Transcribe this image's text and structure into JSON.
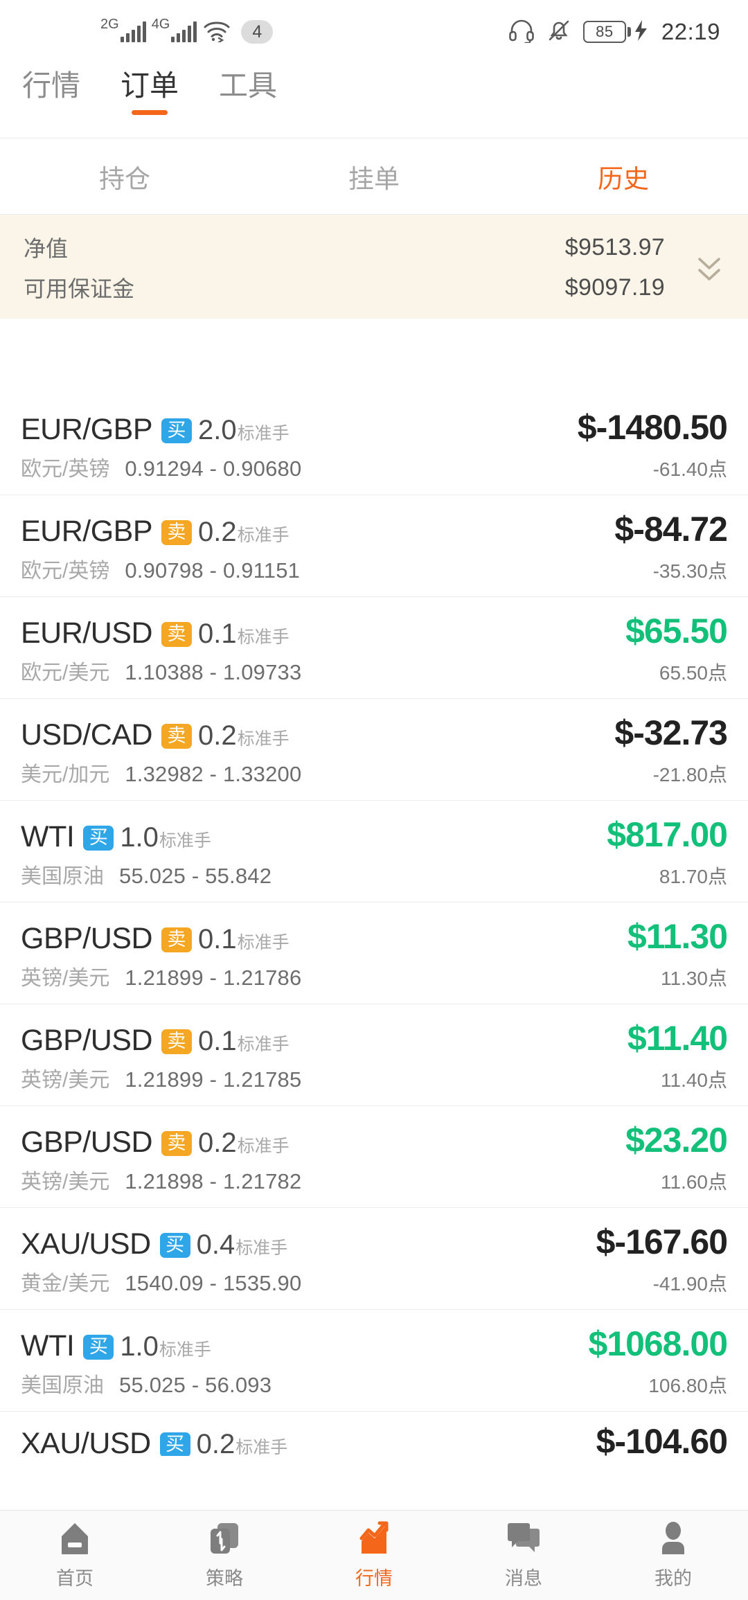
{
  "status_bar": {
    "net1_label": "2G",
    "net2_label": "4G",
    "sim_badge": "4",
    "battery_level": "85",
    "time": "22:19",
    "icons": [
      "headphone-icon",
      "bell-muted-icon",
      "battery-icon",
      "charging-bolt-icon",
      "wifi-icon",
      "signal-bars-icon"
    ]
  },
  "top_tabs": [
    {
      "label": "行情",
      "active": false
    },
    {
      "label": "订单",
      "active": true
    },
    {
      "label": "工具",
      "active": false
    }
  ],
  "sub_tabs": [
    {
      "label": "持仓",
      "active": false
    },
    {
      "label": "挂单",
      "active": false
    },
    {
      "label": "历史",
      "active": true
    }
  ],
  "account_summary": {
    "equity_label": "净值",
    "equity_value": "$9513.97",
    "free_margin_label": "可用保证金",
    "free_margin_value": "$9097.19",
    "expand_icon": "double-chevron-down-icon"
  },
  "lot_unit": "标准手",
  "point_unit": "点",
  "orders": [
    {
      "symbol": "EUR/GBP",
      "side": "买",
      "side_type": "buy",
      "lots": "2.0",
      "cn_name": "欧元/英镑",
      "open_price": "0.91294",
      "close_price": "0.90680",
      "price_range": "0.91294 - 0.90680",
      "profit": "$-1480.50",
      "profit_sign": "neg",
      "points": "-61.40点"
    },
    {
      "symbol": "EUR/GBP",
      "side": "卖",
      "side_type": "sell",
      "lots": "0.2",
      "cn_name": "欧元/英镑",
      "open_price": "0.90798",
      "close_price": "0.91151",
      "price_range": "0.90798 - 0.91151",
      "profit": "$-84.72",
      "profit_sign": "neg",
      "points": "-35.30点"
    },
    {
      "symbol": "EUR/USD",
      "side": "卖",
      "side_type": "sell",
      "lots": "0.1",
      "cn_name": "欧元/美元",
      "open_price": "1.10388",
      "close_price": "1.09733",
      "price_range": "1.10388 - 1.09733",
      "profit": "$65.50",
      "profit_sign": "pos",
      "points": "65.50点"
    },
    {
      "symbol": "USD/CAD",
      "side": "卖",
      "side_type": "sell",
      "lots": "0.2",
      "cn_name": "美元/加元",
      "open_price": "1.32982",
      "close_price": "1.33200",
      "price_range": "1.32982 - 1.33200",
      "profit": "$-32.73",
      "profit_sign": "neg",
      "points": "-21.80点"
    },
    {
      "symbol": "WTI",
      "side": "买",
      "side_type": "buy",
      "lots": "1.0",
      "cn_name": "美国原油",
      "open_price": "55.025",
      "close_price": "55.842",
      "price_range": "55.025 - 55.842",
      "profit": "$817.00",
      "profit_sign": "pos",
      "points": "81.70点"
    },
    {
      "symbol": "GBP/USD",
      "side": "卖",
      "side_type": "sell",
      "lots": "0.1",
      "cn_name": "英镑/美元",
      "open_price": "1.21899",
      "close_price": "1.21786",
      "price_range": "1.21899 - 1.21786",
      "profit": "$11.30",
      "profit_sign": "pos",
      "points": "11.30点"
    },
    {
      "symbol": "GBP/USD",
      "side": "卖",
      "side_type": "sell",
      "lots": "0.1",
      "cn_name": "英镑/美元",
      "open_price": "1.21899",
      "close_price": "1.21785",
      "price_range": "1.21899 - 1.21785",
      "profit": "$11.40",
      "profit_sign": "pos",
      "points": "11.40点"
    },
    {
      "symbol": "GBP/USD",
      "side": "卖",
      "side_type": "sell",
      "lots": "0.2",
      "cn_name": "英镑/美元",
      "open_price": "1.21898",
      "close_price": "1.21782",
      "price_range": "1.21898 - 1.21782",
      "profit": "$23.20",
      "profit_sign": "pos",
      "points": "11.60点"
    },
    {
      "symbol": "XAU/USD",
      "side": "买",
      "side_type": "buy",
      "lots": "0.4",
      "cn_name": "黄金/美元",
      "open_price": "1540.09",
      "close_price": "1535.90",
      "price_range": "1540.09 - 1535.90",
      "profit": "$-167.60",
      "profit_sign": "neg",
      "points": "-41.90点"
    },
    {
      "symbol": "WTI",
      "side": "买",
      "side_type": "buy",
      "lots": "1.0",
      "cn_name": "美国原油",
      "open_price": "55.025",
      "close_price": "56.093",
      "price_range": "55.025 - 56.093",
      "profit": "$1068.00",
      "profit_sign": "pos",
      "points": "106.80点"
    },
    {
      "symbol": "XAU/USD",
      "side": "买",
      "side_type": "buy",
      "lots": "0.2",
      "cn_name": "",
      "open_price": "",
      "close_price": "",
      "price_range": "",
      "profit": "$-104.60",
      "profit_sign": "neg",
      "points": "",
      "clipped": true
    }
  ],
  "bottom_nav": [
    {
      "label": "首页",
      "icon": "home-icon",
      "active": false
    },
    {
      "label": "策略",
      "icon": "swap-strategy-icon",
      "active": false
    },
    {
      "label": "行情",
      "icon": "chart-trend-icon",
      "active": true
    },
    {
      "label": "消息",
      "icon": "message-bubble-icon",
      "active": false
    },
    {
      "label": "我的",
      "icon": "person-icon",
      "active": false
    }
  ],
  "colors": {
    "accent_orange": "#f4661a",
    "buy_blue": "#2ea6e8",
    "sell_orange": "#f5a623",
    "profit_green": "#12c07a",
    "loss_black": "#222222",
    "summary_bg": "#fbf5e9"
  }
}
